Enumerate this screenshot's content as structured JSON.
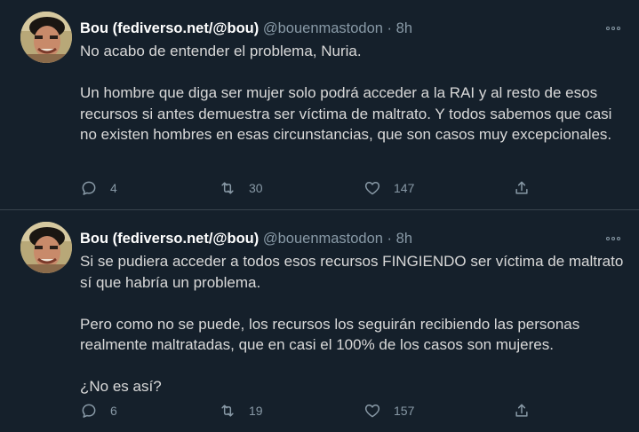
{
  "tweets": [
    {
      "author_name": "Bou (fediverso.net/@bou)",
      "handle": "@bouenmastodon",
      "separator": "·",
      "time": "8h",
      "paragraphs": [
        "No acabo de entender el problema, Nuria.",
        "Un hombre que diga ser mujer solo podrá acceder a la RAI y al resto de esos recursos si antes demuestra ser víctima de maltrato. Y todos sabemos que casi no existen hombres en esas circunstancias, que son casos muy excepcionales."
      ],
      "replies": "4",
      "retweets": "30",
      "likes": "147"
    },
    {
      "author_name": "Bou (fediverso.net/@bou)",
      "handle": "@bouenmastodon",
      "separator": "·",
      "time": "8h",
      "paragraphs": [
        "Si se pudiera acceder a todos esos recursos FINGIENDO ser víctima de maltrato sí que habría un problema.",
        "Pero como no se puede, los recursos los seguirán recibiendo las personas realmente maltratadas, que en casi el 100% de los casos son mujeres.",
        "¿No es así?"
      ],
      "replies": "6",
      "retweets": "19",
      "likes": "157"
    }
  ],
  "icons": {
    "reply": "reply-icon",
    "retweet": "retweet-icon",
    "like": "like-icon",
    "share": "share-icon",
    "more": "more-icon"
  },
  "colors": {
    "background": "#15202b",
    "text": "#d9d9d9",
    "secondary": "#8899a6",
    "divider": "#38444d"
  }
}
